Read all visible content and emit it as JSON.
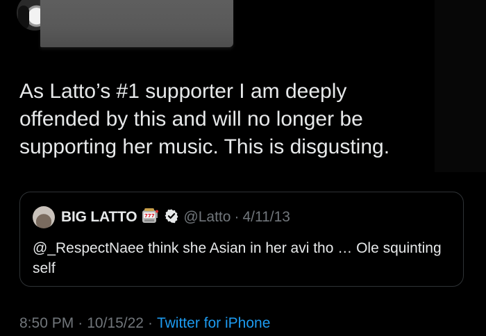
{
  "tweet": {
    "text": "As Latto’s #1 supporter I am deeply\noffended by this and will no longer be\nsupporting her music. This is disgusting."
  },
  "quoted_tweet": {
    "display_name": "BIG LATTO",
    "emoji": "slot-machine-icon",
    "verified": "verified-badge-icon",
    "handle": "@Latto",
    "separator": "·",
    "date": "4/11/13",
    "text": "@_RespectNaee think she Asian in her avi tho … Ole squinting self"
  },
  "meta": {
    "time": "8:50 PM",
    "separator": "·",
    "date": "10/15/22",
    "separator2": "·",
    "source": "Twitter for iPhone"
  },
  "colors": {
    "background": "#000000",
    "primary_text": "#e7e9ea",
    "secondary_text": "#71767b",
    "link": "#1d9bf0",
    "border": "#2f3336",
    "redaction": "#5a5a5a"
  }
}
